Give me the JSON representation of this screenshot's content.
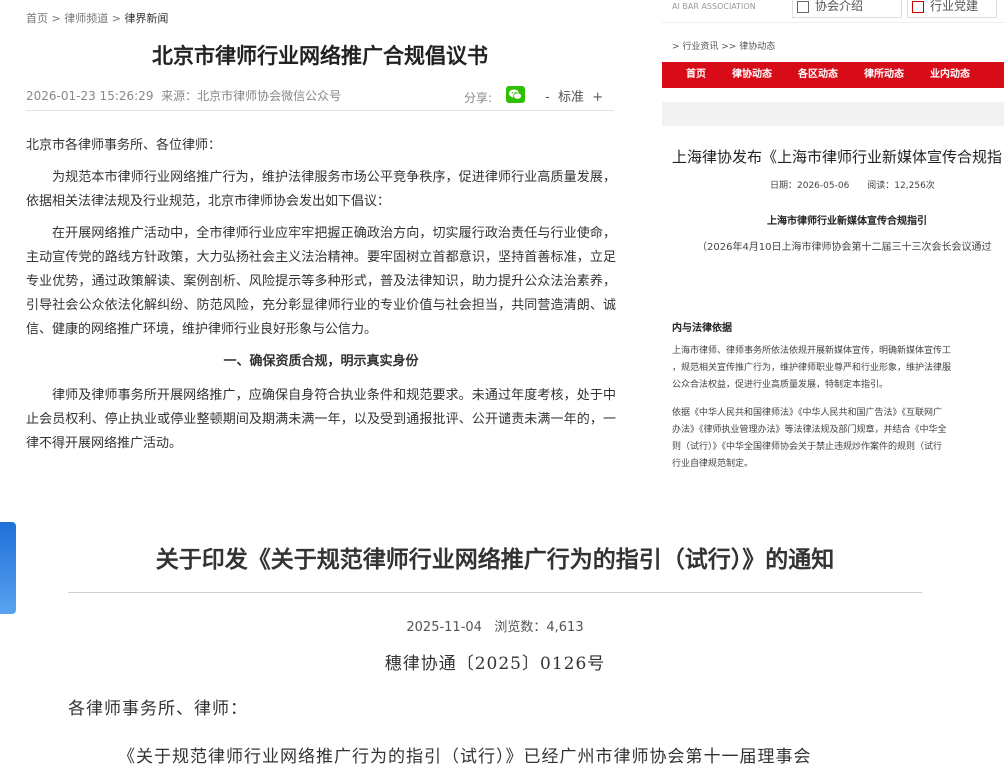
{
  "beijing": {
    "breadcrumb": {
      "home": "首页",
      "sep": ">",
      "channel": "律师频道",
      "current": "律界新闻"
    },
    "title": "北京市律师行业网络推广合规倡议书",
    "datetime": "2026-01-23 15:26:29",
    "source": "来源：北京市律师协会微信公众号",
    "share_label": "分享:",
    "font_minus": "-",
    "font_label": "标准",
    "font_plus": "+",
    "paragraphs": [
      "北京市各律师事务所、各位律师：",
      "为规范本市律师行业网络推广行为，维护法律服务市场公平竞争秩序，促进律师行业高质量发展，依据相关法律法规及行业规范，北京市律师协会发出如下倡议：",
      "在开展网络推广活动中，全市律师行业应牢牢把握正确政治方向，切实履行政治责任与行业使命，主动宣传党的路线方针政策，大力弘扬社会主义法治精神。要牢固树立首都意识，坚持首善标准，立足专业优势，通过政策解读、案例剖析、风险提示等多种形式，普及法律知识，助力提升公众法治素养，引导社会公众依法化解纠纷、防范风险，充分彰显律师行业的专业价值与社会担当，共同营造清朗、诚信、健康的网络推广环境，维护律师行业良好形象与公信力。",
      "一、确保资质合规，明示真实身份",
      "律师及律师事务所开展网络推广，应确保自身符合执业条件和规范要求。未通过年度考核，处于中止会员权利、停止执业或停业整顿期间及期满未满一年，以及受到通报批评、公开谴责未满一年的，一律不得开展网络推广活动。"
    ]
  },
  "shanghai": {
    "association": "AI BAR ASSOCIATION",
    "topbar_btn1": "协会介绍",
    "topbar_btn2": "行业党建",
    "breadcrumb": "> 行业资讯 >> 律协动态",
    "nav": [
      "首页",
      "律协动态",
      "各区动态",
      "律所动态",
      "业内动态"
    ],
    "title": "上海律协发布《上海市律师行业新媒体宣传合规指",
    "meta": "日期：2026-05-06　　阅读：12,256次",
    "doc_title": "上海市律师行业新媒体宣传合规指引",
    "doc_subtitle": "（2026年4月10日上海市律师协会第十二届三十三次会长会议通过",
    "section": "内与法律依据",
    "para1": [
      "上海市律师、律师事务所依法依规开展新媒体宣传，明确新媒体宣传工",
      "，规范相关宣传推广行为，维护律师职业尊严和行业形象，维护法律服",
      "公众合法权益，促进行业高质量发展，特制定本指引。"
    ],
    "para2": [
      "依据《中华人民共和国律师法》《中华人民共和国广告法》《互联网广",
      "办法》《律师执业管理办法》等法律法规及部门规章，并结合《中华全",
      "则（试行）》《中华全国律师协会关于禁止违规炒作案件的规则（试行",
      "行业自律规范制定。"
    ]
  },
  "guangzhou": {
    "title": "关于印发《关于规范律师行业网络推广行为的指引（试行）》的通知",
    "date": "2025-11-04",
    "views_label": "浏览数：",
    "views": "4,613",
    "doc_number": "穗律协通〔2025〕0126号",
    "addressee": "各律师事务所、律师：",
    "first_line": "《关于规范律师行业网络推广行为的指引（试行）》已经广州市律师协会第十一届理事会"
  },
  "colors": {
    "sh_nav_red": "#d80c18",
    "wechat_green": "#2dc100"
  }
}
